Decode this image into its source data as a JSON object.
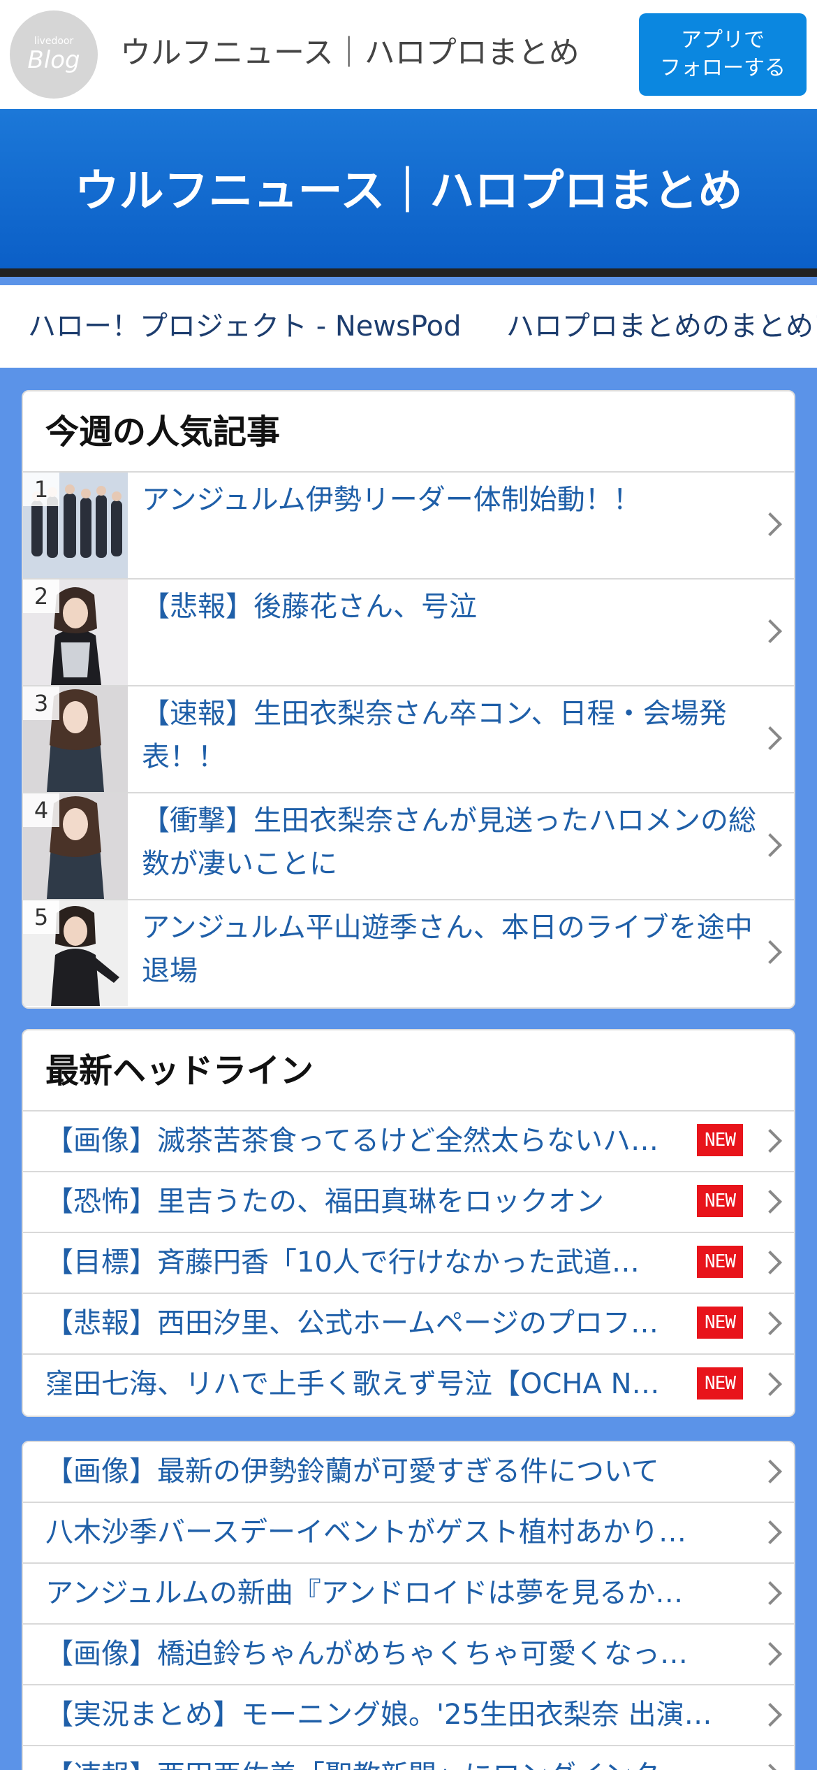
{
  "header": {
    "logo_small": "livedoor",
    "logo_big": "Blog",
    "site_title": "ウルフニュース｜ハロプロまとめ",
    "follow_line1": "アプリで",
    "follow_line2": "フォローする"
  },
  "banner": {
    "title": "ウルフニュース｜ハロプロまとめ"
  },
  "links": [
    "ハロー！プロジェクト - NewsPod",
    "ハロプロまとめのまとめア"
  ],
  "popular": {
    "title": "今週の人気記事",
    "items": [
      {
        "rank": "1",
        "text": "アンジュルム伊勢リーダー体制始動！！"
      },
      {
        "rank": "2",
        "text": "【悲報】後藤花さん、号泣"
      },
      {
        "rank": "3",
        "text": "【速報】生田衣梨奈さん卒コン、日程・会場発表！！"
      },
      {
        "rank": "4",
        "text": "【衝撃】生田衣梨奈さんが見送ったハロメンの総数が凄いことに"
      },
      {
        "rank": "5",
        "text": "アンジュルム平山遊季さん、本日のライブを途中退場"
      }
    ]
  },
  "headlines": {
    "title": "最新ヘッドライン",
    "new_label": "NEW",
    "items": [
      "【画像】滅茶苦茶食ってるけど全然太らないハ…",
      "【恐怖】里吉うたの、福田真琳をロックオン",
      "【目標】斉藤円香「10人で行けなかった武道…",
      "【悲報】西田汐里、公式ホームページのプロフ…",
      "窪田七海、リハで上手く歌えず号泣【OCHA N…"
    ]
  },
  "more": {
    "items": [
      "【画像】最新の伊勢鈴蘭が可愛すぎる件について",
      "八木沙季バースデーイベントがゲスト植村あかり…",
      "アンジュルムの新曲『アンドロイドは夢を見るか…",
      "【画像】橋迫鈴ちゃんがめちゃくちゃ可愛くなっ…",
      "【実況まとめ】モーニング娘。'25生田衣梨奈 出演…",
      "【速報】西田亜佐美「聖教新聞」にロングインタ…"
    ]
  }
}
